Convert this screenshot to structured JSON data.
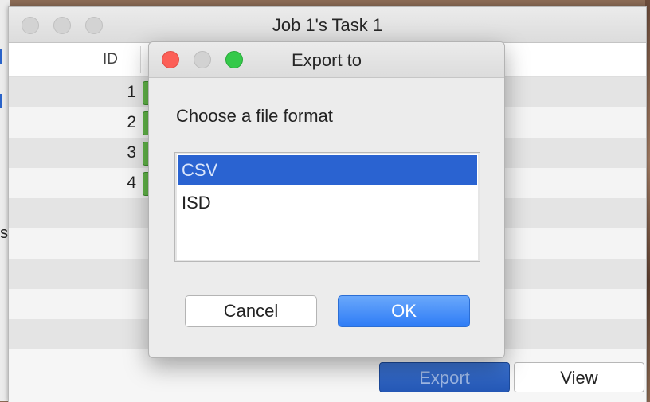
{
  "background_app": {
    "edge_text": "s"
  },
  "main_window": {
    "title": "Job 1's Task 1",
    "table": {
      "column_id_header": "ID",
      "rows": [
        {
          "id": "1"
        },
        {
          "id": "2"
        },
        {
          "id": "3"
        },
        {
          "id": "4"
        }
      ]
    },
    "export_label": "Export",
    "view_label": "View"
  },
  "dialog": {
    "title": "Export to",
    "prompt": "Choose a file format",
    "formats": [
      "CSV",
      "ISD"
    ],
    "selected_format": "CSV",
    "cancel_label": "Cancel",
    "ok_label": "OK"
  },
  "colors": {
    "selection": "#2a63d1",
    "status_green": "#63b84a",
    "ok_button": "#2e7cf6",
    "close_red": "#fc5f57",
    "zoom_green": "#35c94a"
  }
}
